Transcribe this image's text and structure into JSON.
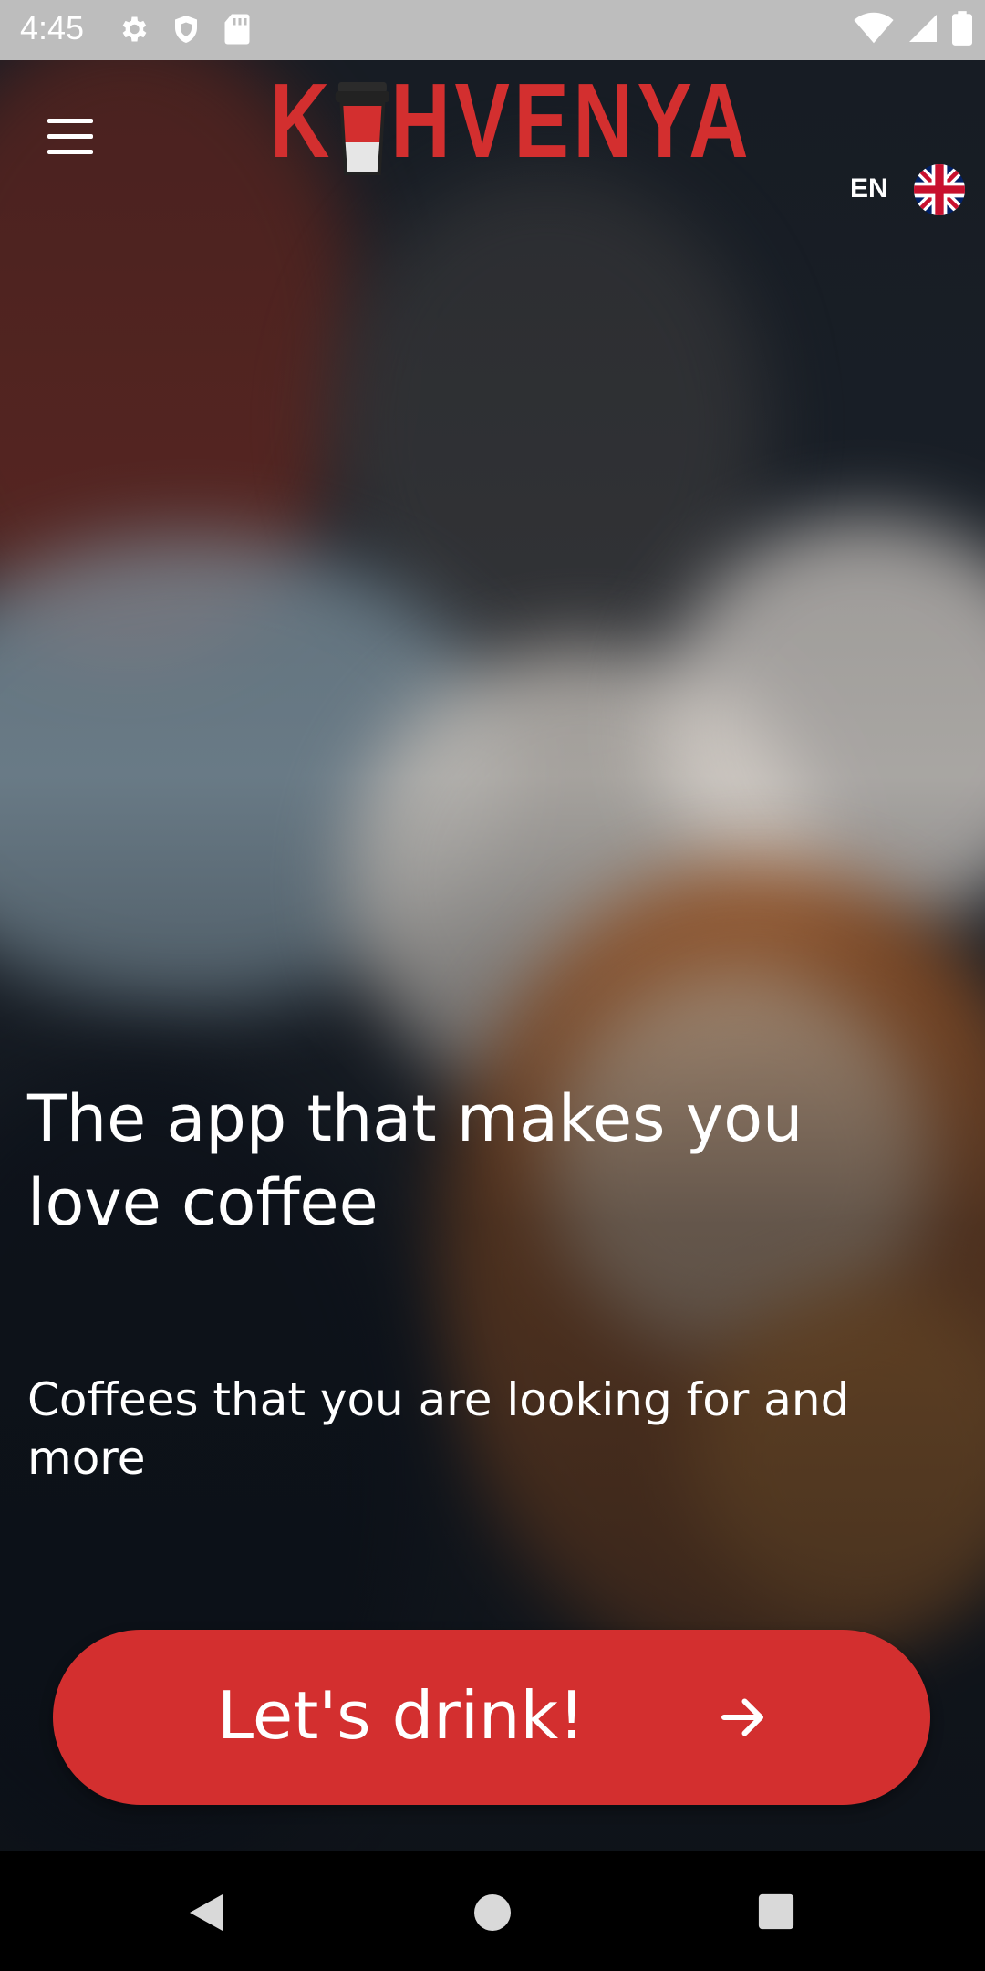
{
  "status_bar": {
    "time": "4:45",
    "left_icons": [
      "settings-icon",
      "shield-icon",
      "sd-card-icon"
    ],
    "right_icons": [
      "wifi-icon",
      "signal-icon",
      "battery-icon"
    ]
  },
  "header": {
    "menu_icon": "hamburger-menu-icon",
    "logo_text_first": "K",
    "logo_text_rest": "HVENYA",
    "language_code": "EN",
    "language_flag": "uk-flag-icon"
  },
  "hero": {
    "headline": "The app that makes you love coffee",
    "subline": "Coffees that you are looking for and more"
  },
  "cta": {
    "label": "Let's drink!",
    "icon": "arrow-right-icon"
  },
  "colors": {
    "accent": "#d32f2f",
    "status_bar": "#bdbdbd",
    "nav_bar": "#000000"
  },
  "nav": {
    "buttons": [
      "back-icon",
      "home-icon",
      "recents-icon"
    ]
  }
}
